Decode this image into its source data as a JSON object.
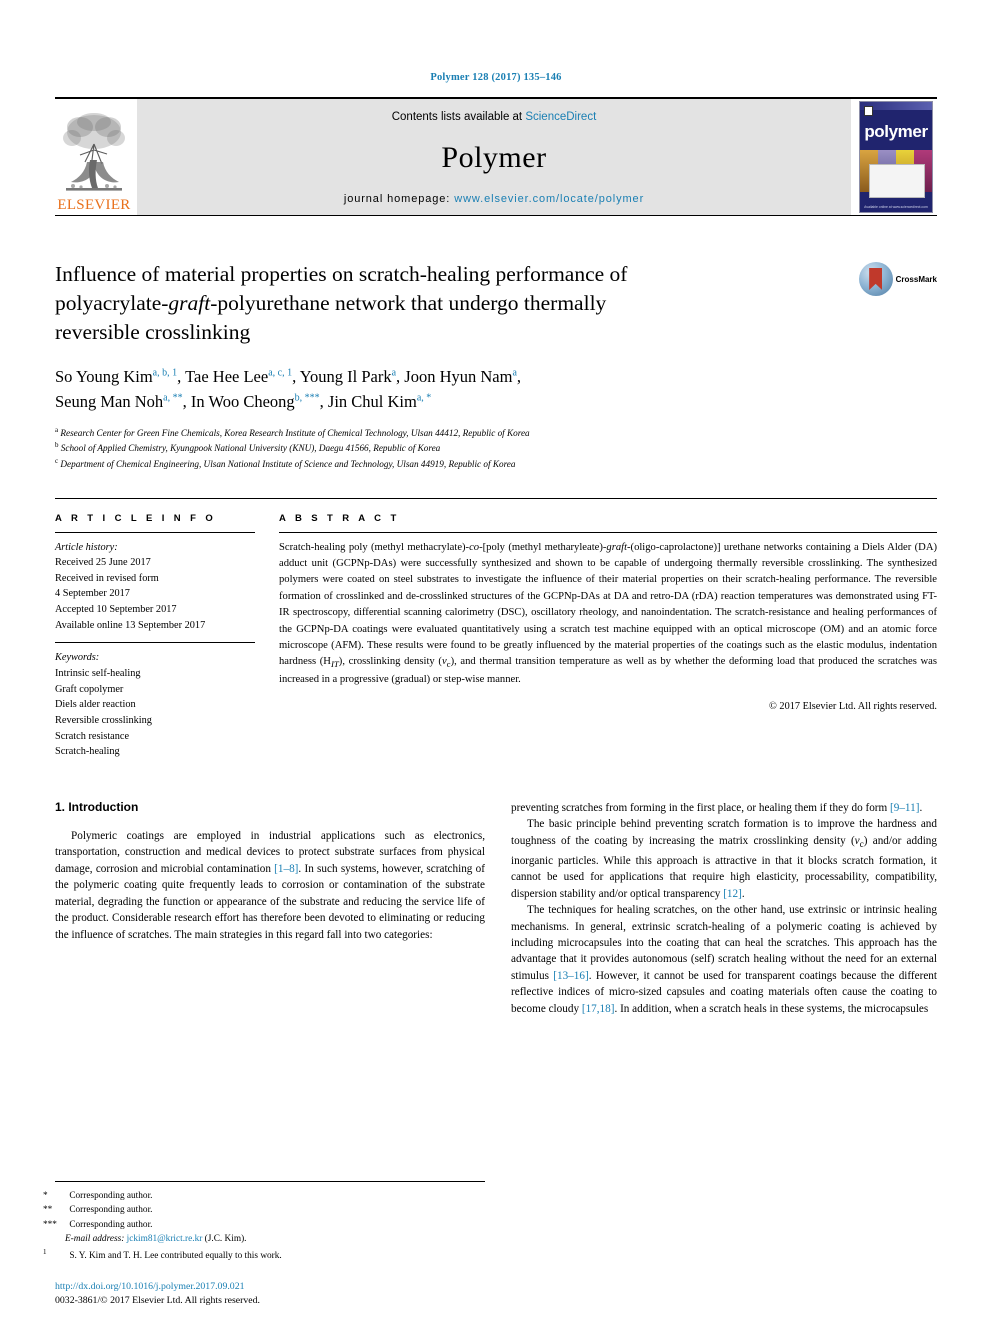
{
  "running_head": "Polymer 128 (2017) 135–146",
  "masthead": {
    "contents_prefix": "Contents lists available at ",
    "sciencedirect": "ScienceDirect",
    "journal_name": "Polymer",
    "homepage_prefix": "journal homepage: ",
    "homepage_url": "www.elsevier.com/locate/polymer",
    "publisher": "ELSEVIER",
    "cover_title": "polymer",
    "cover_footer": "Available online at www.sciencedirect.com",
    "accent_color": "#1a7fb3",
    "elsevier_orange": "#E9711C"
  },
  "title": {
    "line1": "Influence of material properties on scratch-healing performance of",
    "line2_a": "polyacrylate-",
    "line2_italic": "graft",
    "line2_b": "-polyurethane network that undergo thermally",
    "line3": "reversible crosslinking",
    "crossmark_label": "CrossMark"
  },
  "authors": {
    "line1": [
      {
        "name": "So Young Kim",
        "sup": "a, b, 1"
      },
      {
        "name": "Tae Hee Lee",
        "sup": "a, c, 1"
      },
      {
        "name": "Young Il Park",
        "sup": "a"
      },
      {
        "name": "Joon Hyun Nam",
        "sup": "a"
      }
    ],
    "line2": [
      {
        "name": "Seung Man Noh",
        "sup": "a, **"
      },
      {
        "name": "In Woo Cheong",
        "sup": "b, ***"
      },
      {
        "name": "Jin Chul Kim",
        "sup": "a, *"
      }
    ],
    "affiliations": [
      {
        "mark": "a",
        "text": "Research Center for Green Fine Chemicals, Korea Research Institute of Chemical Technology, Ulsan 44412, Republic of Korea"
      },
      {
        "mark": "b",
        "text": "School of Applied Chemistry, Kyungpook National University (KNU), Daegu 41566, Republic of Korea"
      },
      {
        "mark": "c",
        "text": "Department of Chemical Engineering, Ulsan National Institute of Science and Technology, Ulsan 44919, Republic of Korea"
      }
    ]
  },
  "article_info": {
    "label": "A R T I C L E   I N F O",
    "history_label": "Article history:",
    "history": [
      "Received 25 June 2017",
      "Received in revised form",
      "4 September 2017",
      "Accepted 10 September 2017",
      "Available online 13 September 2017"
    ],
    "keywords_label": "Keywords:",
    "keywords": [
      "Intrinsic self-healing",
      "Graft copolymer",
      "Diels alder reaction",
      "Reversible crosslinking",
      "Scratch resistance",
      "Scratch-healing"
    ]
  },
  "abstract": {
    "label": "A B S T R A C T",
    "p1_a": "Scratch-healing poly (methyl methacrylate)-",
    "p1_co": "co",
    "p1_b": "-[poly (methyl metharyleate)-",
    "p1_graft": "graft",
    "p1_c": "-(oligo-caprolactone)] urethane networks containing a Diels Alder (DA) adduct unit (GCPNp-DAs) were successfully synthesized and shown to be capable of undergoing thermally reversible crosslinking. The synthesized polymers were coated on steel substrates to investigate the influence of their material properties on their scratch-healing performance. The reversible formation of crosslinked and de-crosslinked structures of the GCPNp-DAs at DA and retro-DA (rDA) reaction temperatures was demonstrated using FT-IR spectroscopy, differential scanning calorimetry (DSC), oscillatory rheology, and nanoindentation. The scratch-resistance and healing performances of the GCPNp-DA coatings were evaluated quantitatively using a scratch test machine equipped with an optical microscope (OM) and an atomic force microscope (AFM). These results were found to be greatly influenced by the material properties of the coatings such as the elastic modulus, indentation hardness (H",
    "sub_it": "IT",
    "p1_d": "), crosslinking density (",
    "sub_vc_v": "v",
    "sub_vc_c": "c",
    "p1_e": "), and thermal transition temperature as well as by whether the deforming load that produced the scratches was increased in a progressive (gradual) or step-wise manner.",
    "copyright": "© 2017 Elsevier Ltd. All rights reserved."
  },
  "introduction": {
    "heading": "1. Introduction",
    "left_p1_a": "Polymeric coatings are employed in industrial applications such as electronics, transportation, construction and medical devices to protect substrate surfaces from physical damage, corrosion and microbial contamination ",
    "left_p1_ref": "[1–8]",
    "left_p1_b": ". In such systems, however, scratching of the polymeric coating quite frequently leads to corrosion or contamination of the substrate material, degrading the function or appearance of the substrate and reducing the service life of the product. Considerable research effort has therefore been devoted to eliminating or reducing the influence of scratches. The main strategies in this regard fall into two categories:",
    "right_p1_a": "preventing scratches from forming in the first place, or healing them if they do form ",
    "right_p1_ref": "[9–11]",
    "right_p1_b": ".",
    "right_p2_a": "The basic principle behind preventing scratch formation is to improve the hardness and toughness of the coating by increasing the matrix crosslinking density (",
    "right_p2_v": "v",
    "right_p2_c": "c",
    "right_p2_b": ") and/or adding inorganic particles. While this approach is attractive in that it blocks scratch formation, it cannot be used for applications that require high elasticity, processability, compatibility, dispersion stability and/or optical transparency ",
    "right_p2_ref": "[12]",
    "right_p2_c2": ".",
    "right_p3_a": "The techniques for healing scratches, on the other hand, use extrinsic or intrinsic healing mechanisms. In general, extrinsic scratch-healing of a polymeric coating is achieved by including microcapsules into the coating that can heal the scratches. This approach has the advantage that it provides autonomous (self) scratch healing without the need for an external stimulus ",
    "right_p3_ref1": "[13–16]",
    "right_p3_b": ". However, it cannot be used for transparent coatings because the different reflective indices of micro-sized capsules and coating materials often cause the coating to become cloudy ",
    "right_p3_ref2": "[17,18]",
    "right_p3_c": ". In addition, when a scratch heals in these systems, the microcapsules"
  },
  "footnotes": {
    "f1_mark": "*",
    "f1_text": "Corresponding author.",
    "f2_mark": "**",
    "f2_text": "Corresponding author.",
    "f3_mark": "***",
    "f3_text": "Corresponding author.",
    "email_label": "E-mail address:",
    "email": "jckim81@krict.re.kr",
    "email_suffix": "(J.C. Kim).",
    "f4_mark": "1",
    "f4_text": "S. Y. Kim and T. H. Lee contributed equally to this work."
  },
  "footer": {
    "doi": "http://dx.doi.org/10.1016/j.polymer.2017.09.021",
    "issn_line": "0032-3861/© 2017 Elsevier Ltd. All rights reserved."
  }
}
